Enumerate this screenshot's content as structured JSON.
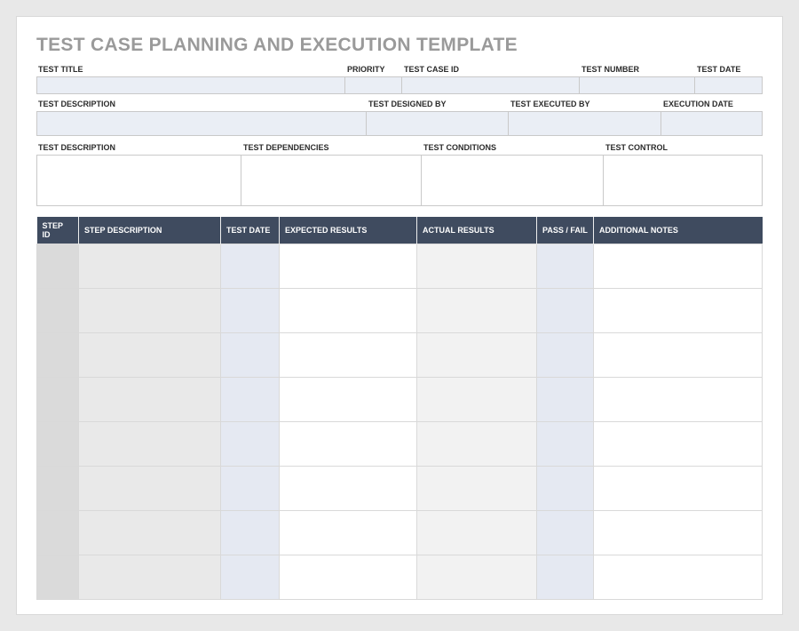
{
  "title": "TEST CASE PLANNING AND EXECUTION TEMPLATE",
  "row1": {
    "test_title": {
      "label": "TEST TITLE",
      "value": ""
    },
    "priority": {
      "label": "PRIORITY",
      "value": ""
    },
    "test_case_id": {
      "label": "TEST CASE ID",
      "value": ""
    },
    "test_number": {
      "label": "TEST NUMBER",
      "value": ""
    },
    "test_date": {
      "label": "TEST DATE",
      "value": ""
    }
  },
  "row2": {
    "test_description": {
      "label": "TEST DESCRIPTION",
      "value": ""
    },
    "designed_by": {
      "label": "TEST DESIGNED BY",
      "value": ""
    },
    "executed_by": {
      "label": "TEST EXECUTED BY",
      "value": ""
    },
    "execution_date": {
      "label": "EXECUTION DATE",
      "value": ""
    }
  },
  "row3": {
    "test_description": {
      "label": "TEST DESCRIPTION",
      "value": ""
    },
    "dependencies": {
      "label": "TEST DEPENDENCIES",
      "value": ""
    },
    "conditions": {
      "label": "TEST CONDITIONS",
      "value": ""
    },
    "control": {
      "label": "TEST CONTROL",
      "value": ""
    }
  },
  "steps": {
    "headers": {
      "step_id": "STEP ID",
      "step_description": "STEP DESCRIPTION",
      "test_date": "TEST DATE",
      "expected": "EXPECTED RESULTS",
      "actual": "ACTUAL RESULTS",
      "pass_fail": "PASS / FAIL",
      "notes": "ADDITIONAL NOTES"
    },
    "rows": [
      {
        "step_id": "",
        "step_description": "",
        "test_date": "",
        "expected": "",
        "actual": "",
        "pass_fail": "",
        "notes": ""
      },
      {
        "step_id": "",
        "step_description": "",
        "test_date": "",
        "expected": "",
        "actual": "",
        "pass_fail": "",
        "notes": ""
      },
      {
        "step_id": "",
        "step_description": "",
        "test_date": "",
        "expected": "",
        "actual": "",
        "pass_fail": "",
        "notes": ""
      },
      {
        "step_id": "",
        "step_description": "",
        "test_date": "",
        "expected": "",
        "actual": "",
        "pass_fail": "",
        "notes": ""
      },
      {
        "step_id": "",
        "step_description": "",
        "test_date": "",
        "expected": "",
        "actual": "",
        "pass_fail": "",
        "notes": ""
      },
      {
        "step_id": "",
        "step_description": "",
        "test_date": "",
        "expected": "",
        "actual": "",
        "pass_fail": "",
        "notes": ""
      },
      {
        "step_id": "",
        "step_description": "",
        "test_date": "",
        "expected": "",
        "actual": "",
        "pass_fail": "",
        "notes": ""
      },
      {
        "step_id": "",
        "step_description": "",
        "test_date": "",
        "expected": "",
        "actual": "",
        "pass_fail": "",
        "notes": ""
      }
    ]
  }
}
